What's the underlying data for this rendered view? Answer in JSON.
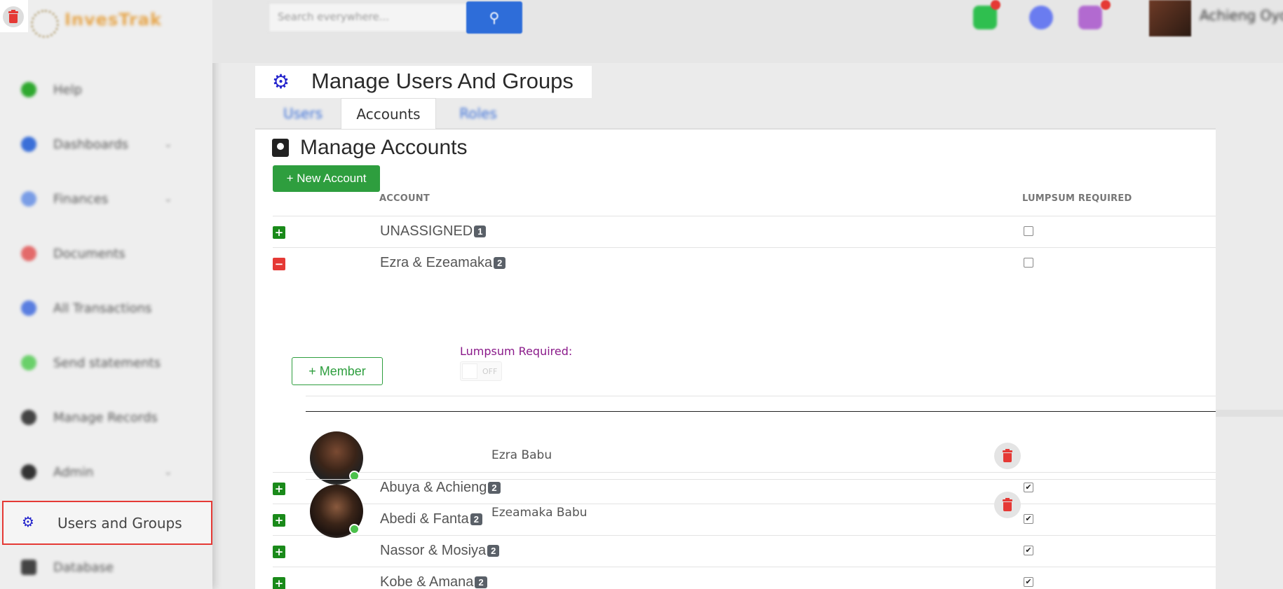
{
  "colors": {
    "accent_green": "#2e9e3e",
    "danger_red": "#e53935",
    "brand_blue": "#2222cc",
    "lumpsum_purple": "#8a1a8a"
  },
  "app": {
    "logo_text": "InvesTrak",
    "delete_icon": "trash-icon"
  },
  "topbar": {
    "search_placeholder": "Search everywhere...",
    "search_icon": "search-icon",
    "user_name": "Achieng Oyoo",
    "icons": [
      "message-icon",
      "bell-icon",
      "documents-icon"
    ]
  },
  "sidebar": {
    "items": [
      {
        "label": "Help",
        "icon": "help-icon",
        "color": "#2fa82f",
        "caret": false
      },
      {
        "label": "Dashboards",
        "icon": "dashboard-icon",
        "color": "#3a6fd8",
        "caret": true
      },
      {
        "label": "Finances",
        "icon": "finances-icon",
        "color": "#7a9de6",
        "caret": true
      },
      {
        "label": "Documents",
        "icon": "documents-icon",
        "color": "#e36a6a",
        "caret": false
      },
      {
        "label": "All Transactions",
        "icon": "transactions-icon",
        "color": "#5a7ee0",
        "caret": false
      },
      {
        "label": "Send statements",
        "icon": "statements-icon",
        "color": "#6ad06a",
        "caret": false
      },
      {
        "label": "Manage Records",
        "icon": "records-icon",
        "color": "#444444",
        "caret": false
      },
      {
        "label": "Admin",
        "icon": "admin-icon",
        "color": "#333333",
        "caret": true
      }
    ],
    "active": {
      "label": "Users and Groups",
      "icon": "users-cog-icon"
    },
    "after": [
      {
        "label": "Database",
        "icon": "database-icon",
        "color": "#444444"
      }
    ]
  },
  "page": {
    "title": "Manage Users And Groups",
    "tabs": [
      {
        "label": "Users",
        "active": false
      },
      {
        "label": "Accounts",
        "active": true
      },
      {
        "label": "Roles",
        "active": false
      }
    ]
  },
  "accounts": {
    "section_title": "Manage Accounts",
    "new_button": "+ New Account",
    "col_account": "ACCOUNT",
    "col_lumpsum": "LUMPSUM REQUIRED",
    "rows": [
      {
        "name": "UNASSIGNED",
        "count": "1",
        "expanded": false,
        "lumpsum": false
      },
      {
        "name": "Ezra & Ezeamaka",
        "count": "2",
        "expanded": true,
        "lumpsum": false
      },
      {
        "name": "Abuya & Achieng",
        "count": "2",
        "expanded": false,
        "lumpsum": true
      },
      {
        "name": "Abedi & Fanta",
        "count": "2",
        "expanded": false,
        "lumpsum": true
      },
      {
        "name": "Nassor & Mosiya",
        "count": "2",
        "expanded": false,
        "lumpsum": true
      },
      {
        "name": "Kobe & Amana",
        "count": "2",
        "expanded": false,
        "lumpsum": true
      }
    ],
    "expanded_panel": {
      "member_button": "+ Member",
      "lumpsum_label": "Lumpsum Required:",
      "switch_text": "OFF",
      "members": [
        {
          "name": "Ezra Babu",
          "online": true
        },
        {
          "name": "Ezeamaka Babu",
          "online": true
        }
      ]
    }
  }
}
